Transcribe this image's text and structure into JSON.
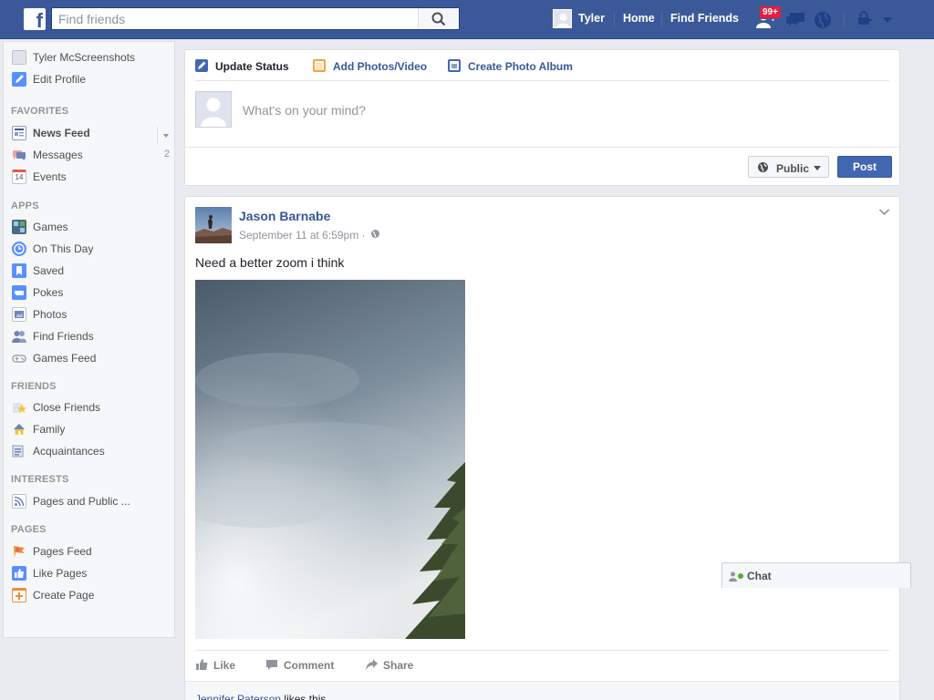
{
  "header": {
    "search_placeholder": "Find friends",
    "user_name": "Tyler",
    "home_label": "Home",
    "find_friends_label": "Find Friends",
    "friend_requests_badge": "99+",
    "brand_color": "#3b5998"
  },
  "sidebar": {
    "profile": [
      {
        "label": "Tyler McScreenshots",
        "icon": "profile-avatar-icon"
      },
      {
        "label": "Edit Profile",
        "icon": "pencil-icon"
      }
    ],
    "favorites_heading": "FAVORITES",
    "favorites": [
      {
        "label": "News Feed",
        "icon": "news-feed-icon",
        "count": ""
      },
      {
        "label": "Messages",
        "icon": "messages-icon",
        "count": "2"
      },
      {
        "label": "Events",
        "icon": "calendar-icon",
        "count": "",
        "icon_text": "14"
      }
    ],
    "apps_heading": "APPS",
    "apps": [
      {
        "label": "Games",
        "icon": "games-icon"
      },
      {
        "label": "On This Day",
        "icon": "clock-icon"
      },
      {
        "label": "Saved",
        "icon": "bookmark-icon"
      },
      {
        "label": "Pokes",
        "icon": "poke-icon"
      },
      {
        "label": "Photos",
        "icon": "photos-icon"
      },
      {
        "label": "Find Friends",
        "icon": "find-friends-icon"
      },
      {
        "label": "Games Feed",
        "icon": "gamepad-icon"
      }
    ],
    "friends_heading": "FRIENDS",
    "friends": [
      {
        "label": "Close Friends",
        "icon": "star-icon"
      },
      {
        "label": "Family",
        "icon": "house-icon"
      },
      {
        "label": "Acquaintances",
        "icon": "list-icon"
      }
    ],
    "interests_heading": "INTERESTS",
    "interests": [
      {
        "label": "Pages and Public ...",
        "icon": "rss-icon"
      }
    ],
    "pages_heading": "PAGES",
    "pages": [
      {
        "label": "Pages Feed",
        "icon": "flag-icon"
      },
      {
        "label": "Like Pages",
        "icon": "thumbs-up-icon"
      },
      {
        "label": "Create Page",
        "icon": "create-page-icon"
      }
    ]
  },
  "composer": {
    "tabs": [
      {
        "label": "Update Status",
        "icon": "pencil-icon"
      },
      {
        "label": "Add Photos/Video",
        "icon": "camera-icon"
      },
      {
        "label": "Create Photo Album",
        "icon": "album-icon"
      }
    ],
    "placeholder": "What's on your mind?",
    "audience_label": "Public",
    "post_label": "Post"
  },
  "story": {
    "author": "Jason Barnabe",
    "timestamp": "September 11 at 6:59pm",
    "separator": "·",
    "text": "Need a better zoom i think",
    "actions": [
      {
        "label": "Like",
        "icon": "thumbs-up-icon"
      },
      {
        "label": "Comment",
        "icon": "comment-icon"
      },
      {
        "label": "Share",
        "icon": "share-arrow-icon"
      }
    ],
    "liker": "Jennifer Paterson",
    "likes_suffix": " likes this."
  },
  "chat": {
    "label": "Chat"
  }
}
